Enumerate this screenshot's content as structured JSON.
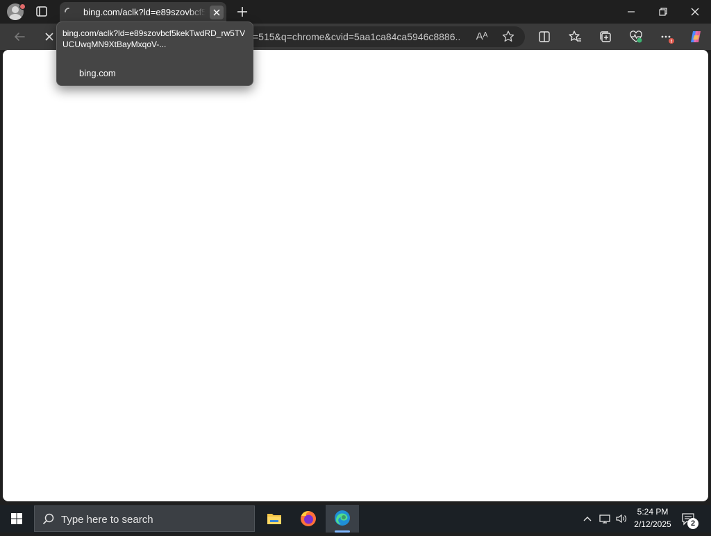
{
  "browser": {
    "tab": {
      "title": "bing.com/aclk?ld=e89szovbcf5kekTwdRD_rw5TVUCUwqMN9XtBayMxqoV-",
      "loading": true
    },
    "address_bar": {
      "visible_text": "=515&q=chrome&cvid=5aa1ca84ca5946c8886..."
    },
    "tooltip": {
      "url": "bing.com/aclk?ld=e89szovbcf5kekTwdRD_rw5TVUCUwqMN9XtBayMxqoV-...",
      "domain": "bing.com"
    },
    "toolbar_icons": [
      "back-icon",
      "stop-icon",
      "read-aloud-icon",
      "favorite-star-icon",
      "split-screen-icon",
      "favorites-icon",
      "collections-icon",
      "browser-essentials-icon",
      "more-icon",
      "copilot-icon"
    ],
    "read_aloud_glyph": "Aᴬ"
  },
  "taskbar": {
    "search_placeholder": "Type here to search",
    "apps": [
      "file-explorer-icon",
      "firefox-icon",
      "edge-icon"
    ],
    "clock": {
      "time": "5:24 PM",
      "date": "2/12/2025"
    },
    "notifications_count": "2"
  },
  "colors": {
    "titlebar": "#1f1f1f",
    "toolbar": "#3a3a3a",
    "tooltip": "#454545",
    "taskbar": "#1b2025",
    "content": "#ffffff"
  }
}
